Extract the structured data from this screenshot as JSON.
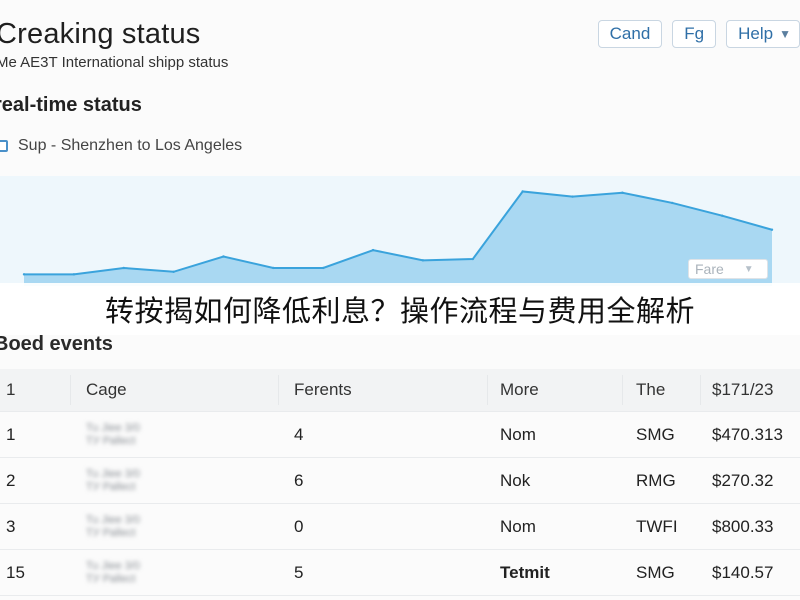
{
  "header": {
    "title": "Creaking status",
    "subtitle": "Me AE3T International shipp status"
  },
  "toolbar": {
    "cand_label": "Cand",
    "fg_label": "Fg",
    "help_label": "Help"
  },
  "realtime": {
    "title": "real-time status",
    "route_label": "Sup - Shenzhen to Los Angeles"
  },
  "chart_data": {
    "type": "area",
    "x": [
      1,
      2,
      3,
      4,
      5,
      6,
      7,
      8,
      9,
      10,
      11,
      12,
      13,
      14,
      15,
      16
    ],
    "series": [
      {
        "values": [
          12,
          12,
          22,
          16,
          40,
          22,
          22,
          50,
          34,
          36,
          142,
          134,
          140,
          124,
          104,
          82
        ]
      }
    ],
    "ylim": [
      0,
      160
    ],
    "fill_color": "#a9d8f2",
    "line_color": "#3aa3dc",
    "select_label": "Fare"
  },
  "banner": {
    "text": "转按揭如何降低利息？操作流程与费用全解析"
  },
  "events": {
    "title": "Boed events",
    "columns": [
      "1",
      "Cage",
      "Ferents",
      "More",
      "The",
      "$171/23"
    ],
    "rows": [
      {
        "id": "1",
        "cage_line1": "Tu Jiee 3/0",
        "cage_line2": "ТУ Раllect",
        "ferents": "4",
        "more": "Nom",
        "the": "SMG",
        "amount": "$470.313"
      },
      {
        "id": "2",
        "cage_line1": "Tu Jiee 3/0",
        "cage_line2": "ТУ Раllect",
        "ferents": "6",
        "more": "Nok",
        "the": "RMG",
        "amount": "$270.32"
      },
      {
        "id": "3",
        "cage_line1": "Tu Jiee 3/0",
        "cage_line2": "ТУ Раllect",
        "ferents": "0",
        "more": "Nom",
        "the": "TWFI",
        "amount": "$800.33"
      },
      {
        "id": "15",
        "cage_line1": "Tu Jiee 3/0",
        "cage_line2": "ТУ Раllect",
        "ferents": "5",
        "more": "Tetmit",
        "the": "SMG",
        "amount": "$140.57"
      }
    ]
  },
  "icons": {
    "help_chevron": "chevron-down-icon",
    "fare_chevron": "chevron-down-icon",
    "route_checkbox": "checkbox-icon"
  }
}
